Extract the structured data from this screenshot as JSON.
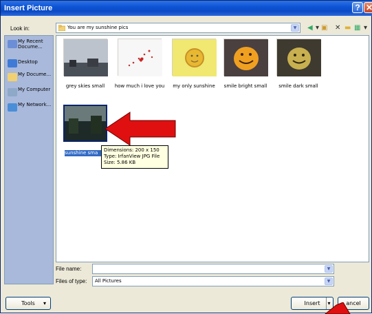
{
  "window": {
    "title": "Insert Picture",
    "help_glyph": "?",
    "close_glyph": "✕"
  },
  "lookin": {
    "label": "Look in:",
    "value": "You are my sunshine pics"
  },
  "places": [
    {
      "label": "My Recent Docume...",
      "icon": "recent-documents-icon"
    },
    {
      "label": "Desktop",
      "icon": "desktop-icon"
    },
    {
      "label": "My Docume...",
      "icon": "my-documents-icon"
    },
    {
      "label": "My Computer",
      "icon": "my-computer-icon"
    },
    {
      "label": "My Network...",
      "icon": "my-network-icon"
    }
  ],
  "files": [
    {
      "label": "grey skies small"
    },
    {
      "label": "how much i love you"
    },
    {
      "label": "my only sunshine"
    },
    {
      "label": "smile bright small"
    },
    {
      "label": "smile dark small"
    },
    {
      "label": "sunshine sma"
    }
  ],
  "tooltip": {
    "dimensions": "Dimensions: 200 x 150",
    "type": "Type: IrfanView JPG File",
    "size": "Size: 5.86 KB"
  },
  "filename": {
    "label": "File name:",
    "value": ""
  },
  "filetype": {
    "label": "Files of type:",
    "value": "All Pictures"
  },
  "buttons": {
    "tools": "Tools",
    "insert": "Insert",
    "cancel": "ancel"
  },
  "colors": {
    "arrow": "#e01010",
    "titlebar": "#0b4ac4",
    "selection": "#316ac5"
  }
}
